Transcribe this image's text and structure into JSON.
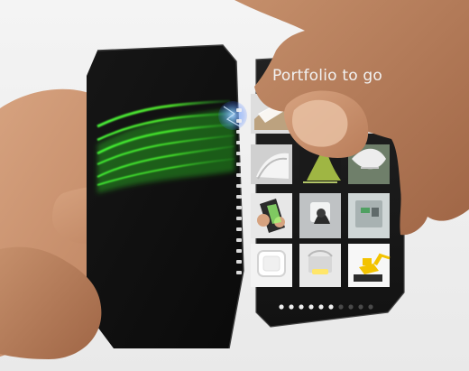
{
  "device": {
    "right_panel_title": "Portfolio to go",
    "pagination": {
      "total": 10,
      "active": 6
    },
    "thumbnail_grid": {
      "rows": 4,
      "cols": 3,
      "items": [
        {
          "name": "folded-paper-thumb"
        },
        {
          "name": "blank-thumb-1"
        },
        {
          "name": "blank-thumb-2"
        },
        {
          "name": "white-shape-thumb"
        },
        {
          "name": "green-light-thumb"
        },
        {
          "name": "chair-thumb"
        },
        {
          "name": "hand-phone-thumb"
        },
        {
          "name": "square-button-thumb"
        },
        {
          "name": "machine-panel-thumb"
        },
        {
          "name": "white-device-thumb"
        },
        {
          "name": "lamp-thumb"
        },
        {
          "name": "excavator-thumb"
        }
      ]
    }
  }
}
